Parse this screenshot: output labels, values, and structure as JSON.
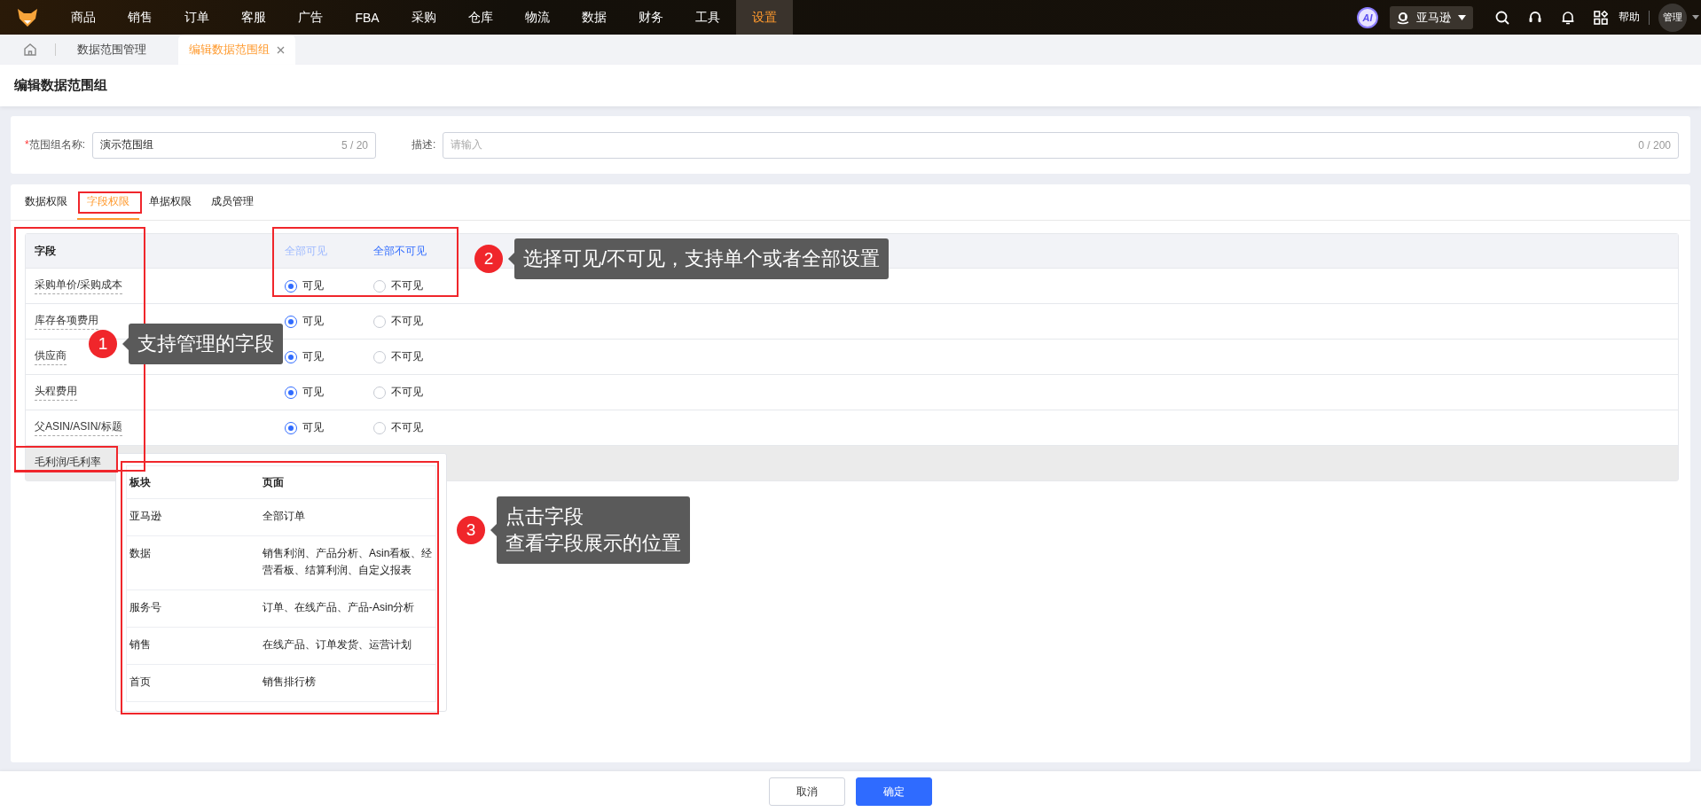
{
  "nav": {
    "items": [
      {
        "label": "商品",
        "selected": false
      },
      {
        "label": "销售",
        "selected": false
      },
      {
        "label": "订单",
        "selected": false
      },
      {
        "label": "客服",
        "selected": false
      },
      {
        "label": "广告",
        "selected": false
      },
      {
        "label": "FBA",
        "selected": false
      },
      {
        "label": "采购",
        "selected": false
      },
      {
        "label": "仓库",
        "selected": false
      },
      {
        "label": "物流",
        "selected": false
      },
      {
        "label": "数据",
        "selected": false
      },
      {
        "label": "财务",
        "selected": false
      },
      {
        "label": "工具",
        "selected": false
      },
      {
        "label": "设置",
        "selected": true
      }
    ],
    "ai_badge": "AI",
    "store": "亚马逊",
    "help": "帮助",
    "user": "管理"
  },
  "page_tabs": [
    {
      "label": "数据范围管理",
      "selected": false
    },
    {
      "label": "编辑数据范围组",
      "selected": true
    }
  ],
  "page_title": "编辑数据范围组",
  "form": {
    "fields": [
      {
        "required_mark": "*",
        "label": "范围组名称:",
        "value": "演示范围组",
        "counter": "5 / 20"
      },
      {
        "label": "描述:",
        "placeholder": "请输入",
        "counter": "0 / 200"
      }
    ]
  },
  "tabs": [
    {
      "label": "数据权限",
      "selected": false
    },
    {
      "label": "字段权限",
      "selected": true
    },
    {
      "label": "单据权限",
      "selected": false
    },
    {
      "label": "成员管理",
      "selected": false
    }
  ],
  "table": {
    "column": "字段",
    "bulk_actions": [
      {
        "label": "全部可见",
        "disabled": true
      },
      {
        "label": "全部不可见",
        "disabled": false
      }
    ],
    "rows": [
      {
        "field": "采购单价/采购成本",
        "hovered": false,
        "options": [
          {
            "label": "可见",
            "selected": true
          },
          {
            "label": "不可见",
            "selected": false
          }
        ]
      },
      {
        "field": "库存各项费用",
        "hovered": false,
        "options": [
          {
            "label": "可见",
            "selected": true
          },
          {
            "label": "不可见",
            "selected": false
          }
        ]
      },
      {
        "field": "供应商",
        "hovered": false,
        "options": [
          {
            "label": "可见",
            "selected": true
          },
          {
            "label": "不可见",
            "selected": false
          }
        ]
      },
      {
        "field": "头程费用",
        "hovered": false,
        "options": [
          {
            "label": "可见",
            "selected": true
          },
          {
            "label": "不可见",
            "selected": false
          }
        ]
      },
      {
        "field": "父ASIN/ASIN/标题",
        "hovered": false,
        "options": [
          {
            "label": "可见",
            "selected": true
          },
          {
            "label": "不可见",
            "selected": false
          }
        ]
      },
      {
        "field": "毛利润/毛利率",
        "hovered": true
      }
    ]
  },
  "popover": {
    "columns": [
      "板块",
      "页面"
    ],
    "rows": [
      [
        "亚马逊",
        "全部订单"
      ],
      [
        "数据",
        "销售利润、产品分析、Asin看板、经营看板、结算利润、自定义报表"
      ],
      [
        "服务号",
        "订单、在线产品、产品-Asin分析"
      ],
      [
        "销售",
        "在线产品、订单发货、运营计划"
      ],
      [
        "首页",
        "销售排行榜"
      ]
    ]
  },
  "callouts": [
    {
      "number": "1",
      "lines": [
        "支持管理的字段"
      ]
    },
    {
      "number": "2",
      "lines": [
        "选择可见/不可见，支持单个或者全部设置"
      ]
    },
    {
      "number": "3",
      "lines": [
        "点击字段",
        "查看字段展示的位置"
      ]
    }
  ],
  "footer": {
    "buttons": [
      {
        "label": "取消",
        "kind": "default"
      },
      {
        "label": "确定",
        "kind": "primary"
      }
    ]
  }
}
